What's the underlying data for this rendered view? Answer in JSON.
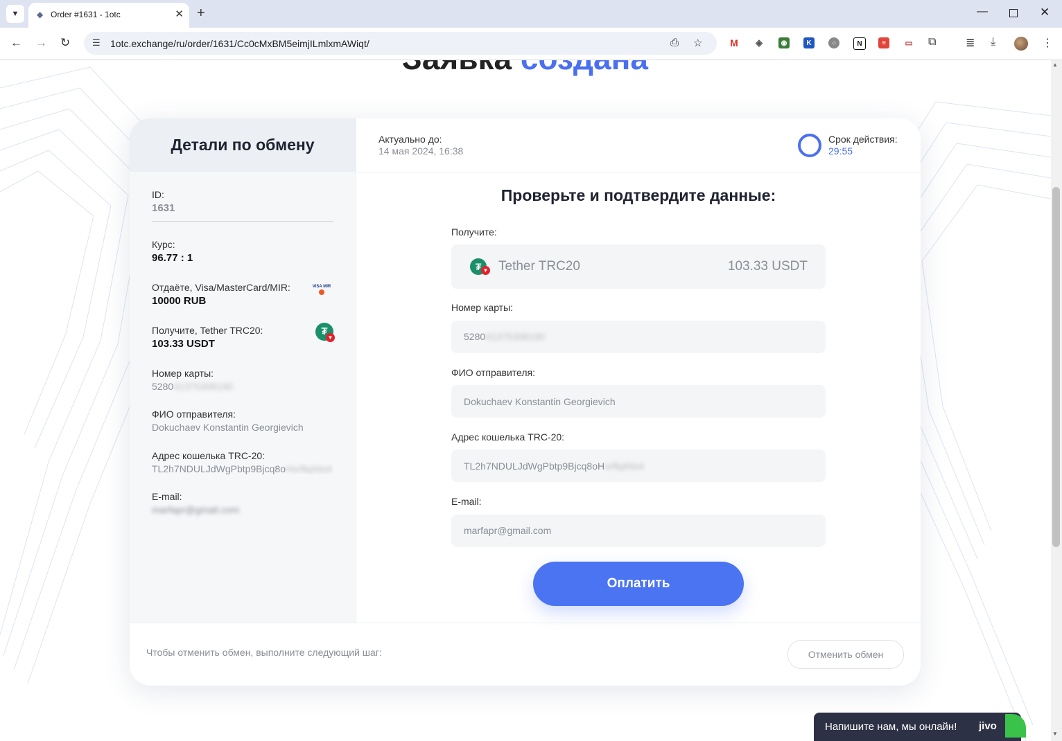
{
  "browser": {
    "tab_title": "Order #1631 - 1otc",
    "url": "1otc.exchange/ru/order/1631/Cc0cMxBM5eimjILmlxmAWiqt/"
  },
  "page": {
    "headline_dark": "Заявка",
    "headline_blue": "создана",
    "sidebar": {
      "title": "Детали по обмену",
      "id_label": "ID:",
      "id_value": "1631",
      "rate_label": "Курс:",
      "rate_value": "96.77 : 1",
      "give_label": "Отдаёте, Visa/MasterCard/MIR:",
      "give_value": "10000 RUB",
      "get_label": "Получите, Tether TRC20:",
      "get_value": "103.33 USDT",
      "card_label": "Номер карты:",
      "card_value": "5280",
      "card_value_hidden": "41375308190",
      "name_label": "ФИО отправителя:",
      "name_value": "Dokuchaev Konstantin Georgievich",
      "wallet_label": "Адрес кошелька TRC-20:",
      "wallet_value": "TL2h7NDULJdWgPbtp9Bjcq8o",
      "wallet_value_hidden": "Hsrfkphts4",
      "email_label": "E-mail:",
      "email_value_hidden": "marfapr@gmail.com",
      "card_logo_text": "VISA MIR",
      "coin_symbol": "₮"
    },
    "validity": {
      "label": "Актуально до:",
      "value": "14 мая 2024, 16:38"
    },
    "timer": {
      "label": "Срок действия:",
      "value": "29:55"
    },
    "form": {
      "title": "Проверьте и подтвердите данные:",
      "receive_label": "Получите:",
      "receive_currency": "Tether TRC20",
      "receive_amount": "103.33 USDT",
      "card_label": "Номер карты:",
      "card_value": "5280",
      "card_value_hidden": "41375308190",
      "name_label": "ФИО отправителя:",
      "name_value": "Dokuchaev Konstantin Georgievich",
      "wallet_label": "Адрес кошелька TRC-20:",
      "wallet_value": "TL2h7NDULJdWgPbtp9Bjcq8oH",
      "wallet_value_hidden": "srfkphts4",
      "email_label": "E-mail:",
      "email_value": "marfapr@gmail.com",
      "pay_button": "Оплатить"
    },
    "footer": {
      "cancel_hint": "Чтобы отменить обмен, выполните следующий шаг:",
      "cancel_button": "Отменить обмен"
    },
    "chat": {
      "text": "Напишите нам, мы онлайн!",
      "logo": "jivo"
    }
  },
  "colors": {
    "accent": "#4a74f2",
    "tether": "#1b8f6a",
    "tron": "#e5202d",
    "chat_bg": "#2d3145"
  }
}
